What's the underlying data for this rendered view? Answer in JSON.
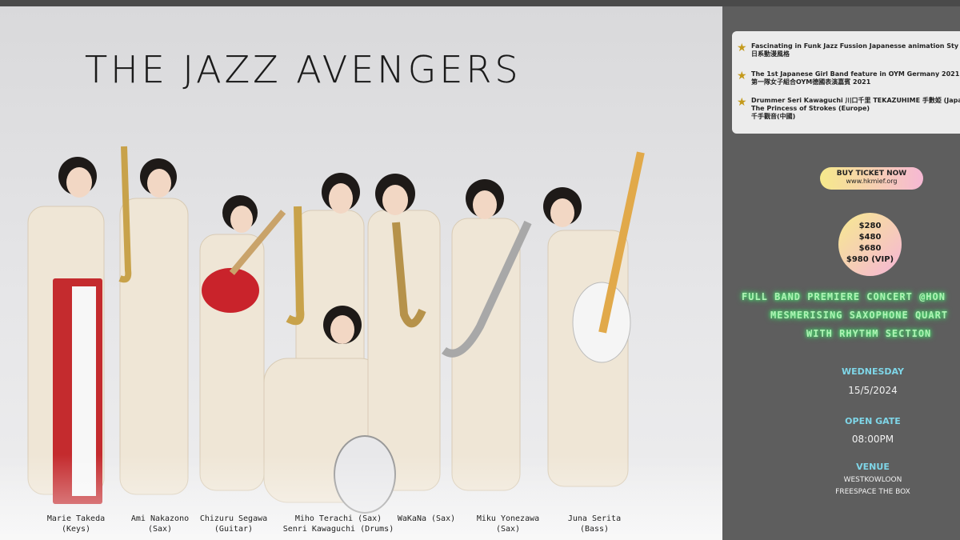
{
  "poster": {
    "title": "THE JAZZ AVENGERS",
    "members": [
      {
        "name": "Marie Takeda",
        "role": "(Keys)"
      },
      {
        "name": "Ami Nakazono",
        "role": "(Sax)"
      },
      {
        "name": "Chizuru Segawa",
        "role": "(Guitar)"
      },
      {
        "name": "Miho Terachi (Sax)",
        "role": "Senri  Kawaguchi (Drums)"
      },
      {
        "name": "WaKaNa (Sax)",
        "role": ""
      },
      {
        "name": "Miku Yonezawa",
        "role": "(Sax)"
      },
      {
        "name": "Juna Serita",
        "role": "(Bass)"
      }
    ]
  },
  "notes": [
    {
      "line1": "Fascinating in Funk Jazz Fussion Japanesse animation Sty",
      "line2": "日系動漫風格"
    },
    {
      "line1": "The 1st Japanese Girl Band feature in OYM Germany 2021",
      "line2": "第一隊女子組合OYM德國表演嘉賓 2021"
    },
    {
      "line1": "Drummer Seri Kawaguchi 川口千里 TEKAZUHIME 手數姫 (Japa",
      "line2": "The Princess of Strokes (Europe)",
      "line3": "千手觀音(中國)"
    }
  ],
  "ticket": {
    "label": "BUY TICKET NOW",
    "url": "www.hkmief.org"
  },
  "prices": [
    "$280",
    "$480",
    "$680",
    "$980 (VIP)"
  ],
  "headline": [
    "FULL BAND PREMIERE CONCERT @HON",
    "MESMERISING SAXOPHONE QUART",
    "WITH RHYTHM SECTION"
  ],
  "event": {
    "day_label": "WEDNESDAY",
    "date": "15/5/2024",
    "gate_label": "OPEN GATE",
    "gate_time": "08:00PM",
    "venue_label": "VENUE",
    "venue_line1": "WESTKOWLOON",
    "venue_line2": "FREESPACE THE BOX"
  },
  "colors": {
    "neon_green": "#aef2b4",
    "label_cyan": "#7fd6e8",
    "star_gold": "#c49a1b"
  }
}
